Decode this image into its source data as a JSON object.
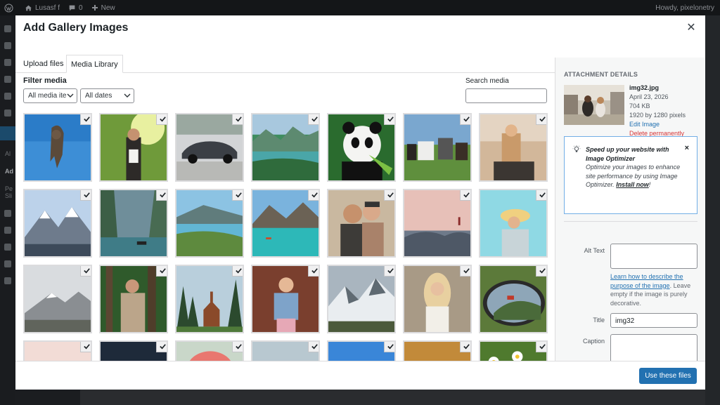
{
  "adminbar": {
    "site_name": "Lusasf f",
    "comments_count": "0",
    "new_label": "New",
    "greeting": "Howdy, pixelonetry"
  },
  "sidemenu": {
    "items": [
      "Al",
      "Ad",
      "Pe",
      "Sli"
    ]
  },
  "modal": {
    "title": "Add Gallery Images",
    "close_icon": "close-icon",
    "tabs": [
      {
        "label": "Upload files",
        "active": false
      },
      {
        "label": "Media Library",
        "active": true
      }
    ]
  },
  "filters": {
    "label": "Filter media",
    "type_select": "All media ite",
    "date_select": "All dates",
    "search_label": "Search media",
    "search_value": ""
  },
  "attachment": {
    "heading": "ATTACHMENT DETAILS",
    "filename": "img32.jpg",
    "date": "April 23, 2026",
    "size": "704 KB",
    "dimensions": "1920 by 1280 pixels",
    "edit_label": "Edit Image",
    "delete_label": "Delete permanently"
  },
  "notice": {
    "title": "Speed up your website with Image Optimizer",
    "body": "Optimize your images to enhance site performance by using Image Optimizer.",
    "link": "Install now",
    "tail": "!",
    "close": "×"
  },
  "fields": {
    "alt_label": "Alt Text",
    "alt_value": "",
    "help_link": "Learn how to describe the purpose of the image",
    "help_text": ". Leave empty if the image is purely decorative.",
    "title_label": "Title",
    "title_value": "img32",
    "caption_label": "Caption",
    "caption_value": ""
  },
  "toolbar": {
    "use_label": "Use these files"
  },
  "colors": {
    "accent": "#2271b1",
    "danger": "#d63638"
  },
  "images": [
    {
      "desc": "monkey-sky"
    },
    {
      "desc": "woman-forest"
    },
    {
      "desc": "car"
    },
    {
      "desc": "tropical-lake"
    },
    {
      "desc": "panda"
    },
    {
      "desc": "horses"
    },
    {
      "desc": "woman-field"
    },
    {
      "desc": "snow-mountains"
    },
    {
      "desc": "fjord-boat"
    },
    {
      "desc": "coast-lake"
    },
    {
      "desc": "turquoise-lake"
    },
    {
      "desc": "two-women"
    },
    {
      "desc": "rocks-sunset"
    },
    {
      "desc": "woman-hat"
    },
    {
      "desc": "misty-mountain"
    },
    {
      "desc": "woman-woods"
    },
    {
      "desc": "church-forest"
    },
    {
      "desc": "woman-laugh"
    },
    {
      "desc": "snowy-peaks"
    },
    {
      "desc": "blonde-woman"
    },
    {
      "desc": "car-mirror"
    },
    {
      "desc": "pink-haze"
    },
    {
      "desc": "city-night"
    },
    {
      "desc": "flamingo"
    },
    {
      "desc": "skyline"
    },
    {
      "desc": "tree-sky"
    },
    {
      "desc": "deer-sunset"
    },
    {
      "desc": "daisies"
    }
  ]
}
